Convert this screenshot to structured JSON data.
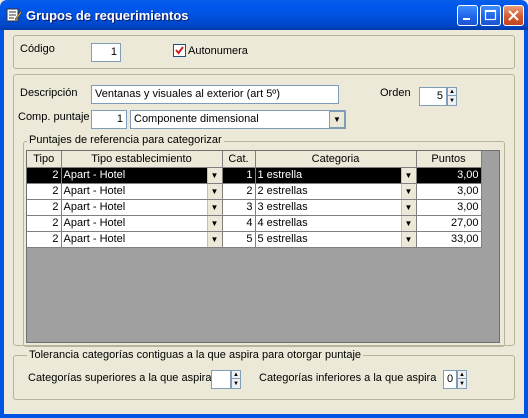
{
  "window": {
    "title": "Grupos de requerimientos"
  },
  "codigo": {
    "label": "Código",
    "value": "1"
  },
  "autonumera": {
    "label": "Autonumera",
    "checked": true
  },
  "descripcion": {
    "label": "Descripción",
    "value": "Ventanas y visuales al exterior (art 5º)"
  },
  "orden": {
    "label": "Orden",
    "value": "5"
  },
  "comp_puntaje": {
    "label": "Comp. puntaje",
    "code": "1",
    "value": "Componente dimensional"
  },
  "puntajes": {
    "caption": "Puntajes de referencia para categorizar",
    "columns": [
      "Tipo",
      "Tipo establecimiento",
      "Cat.",
      "Categoria",
      "Puntos"
    ],
    "rows": [
      {
        "tipo": "2",
        "establecimiento": "Apart - Hotel",
        "cat": "1",
        "categoria": "1 estrella",
        "puntos": "3,00"
      },
      {
        "tipo": "2",
        "establecimiento": "Apart - Hotel",
        "cat": "2",
        "categoria": "2 estrellas",
        "puntos": "3,00"
      },
      {
        "tipo": "2",
        "establecimiento": "Apart - Hotel",
        "cat": "3",
        "categoria": "3 estrellas",
        "puntos": "3,00"
      },
      {
        "tipo": "2",
        "establecimiento": "Apart - Hotel",
        "cat": "4",
        "categoria": "4 estrellas",
        "puntos": "27,00"
      },
      {
        "tipo": "2",
        "establecimiento": "Apart - Hotel",
        "cat": "5",
        "categoria": "5 estrellas",
        "puntos": "33,00"
      }
    ]
  },
  "tolerancia": {
    "caption": "Tolerancia categorías contiguas a la que aspira para otorgar puntaje",
    "superiores_label": "Categorías superiores a la que aspira",
    "superiores_value": "",
    "inferiores_label": "Categorías inferiores a la que aspira",
    "inferiores_value": "0"
  },
  "icons": {
    "window": "form-edit-icon",
    "minimize": "minimize-icon",
    "maximize": "maximize-icon",
    "close": "close-icon"
  },
  "colors": {
    "titlebar": "#0054e3",
    "close": "#d65a2f",
    "check": "#d02020",
    "selection": "#000000"
  }
}
